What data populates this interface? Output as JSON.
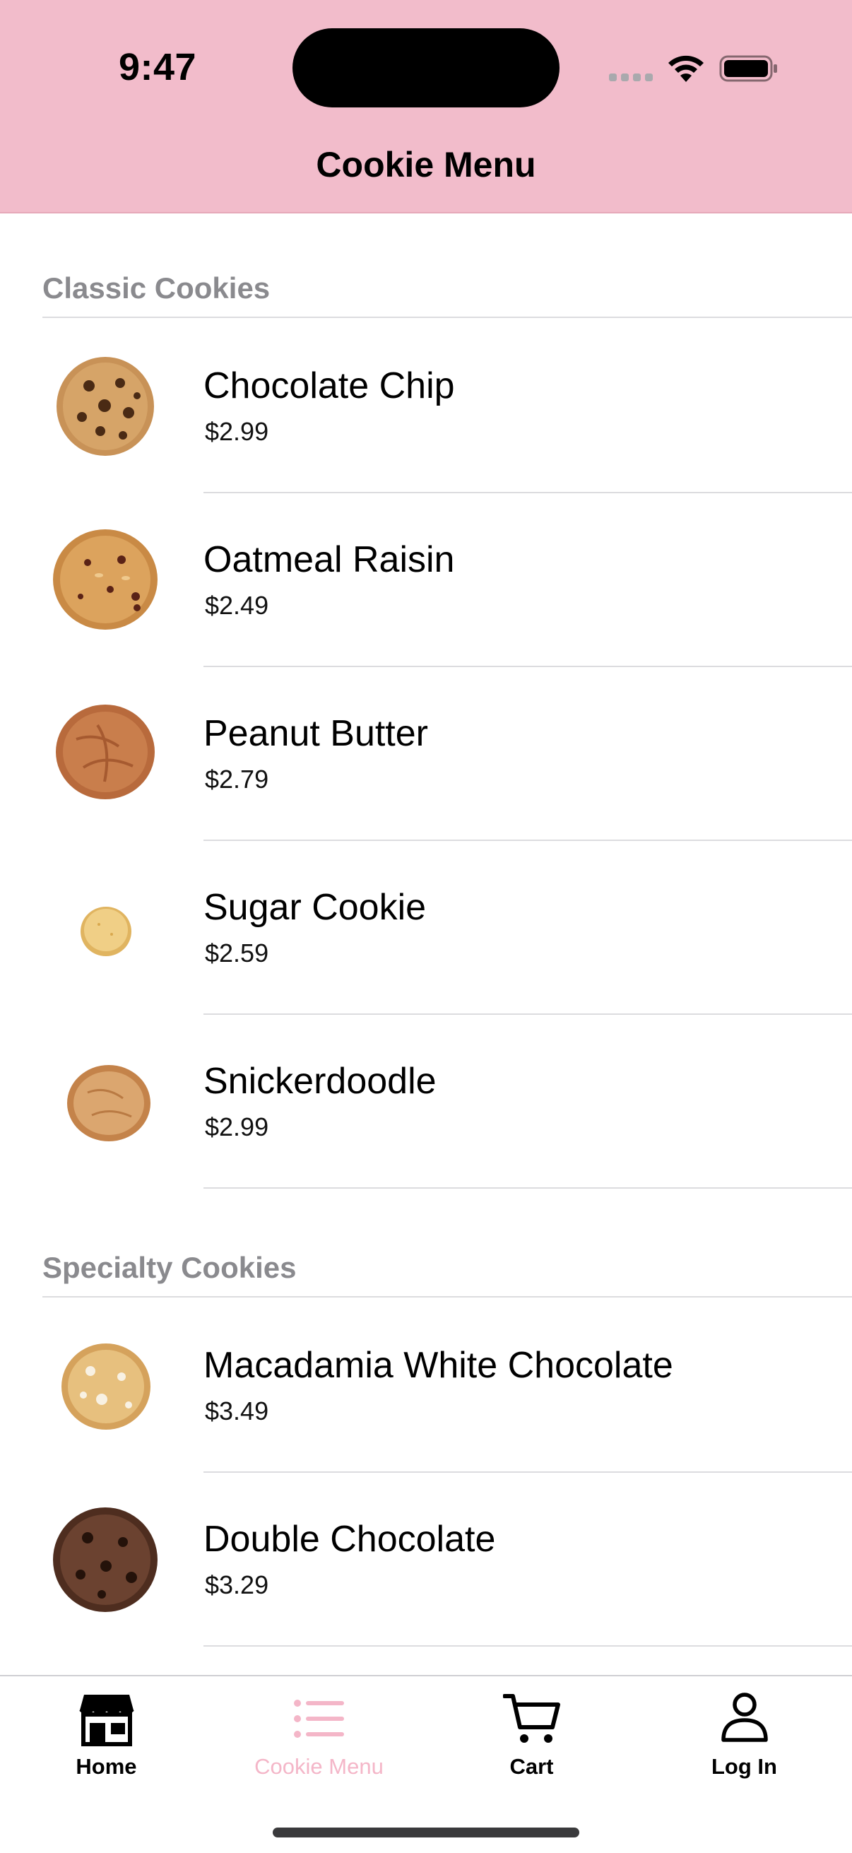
{
  "status_bar": {
    "time": "9:47"
  },
  "nav": {
    "title": "Cookie Menu"
  },
  "sections": [
    {
      "title": "Classic Cookies",
      "items": [
        {
          "name": "Chocolate Chip",
          "price": "$2.99",
          "image": "chocolate-chip-cookie"
        },
        {
          "name": "Oatmeal Raisin",
          "price": "$2.49",
          "image": "oatmeal-raisin-cookie"
        },
        {
          "name": "Peanut Butter",
          "price": "$2.79",
          "image": "peanut-butter-cookie"
        },
        {
          "name": "Sugar Cookie",
          "price": "$2.59",
          "image": "sugar-cookie"
        },
        {
          "name": "Snickerdoodle",
          "price": "$2.99",
          "image": "snickerdoodle-cookie"
        }
      ]
    },
    {
      "title": "Specialty Cookies",
      "items": [
        {
          "name": "Macadamia White Chocolate",
          "price": "$3.49",
          "image": "macadamia-cookie"
        },
        {
          "name": "Double Chocolate",
          "price": "$3.29",
          "image": "double-chocolate-cookie"
        }
      ]
    }
  ],
  "tab_bar": {
    "tabs": [
      {
        "label": "Home",
        "icon": "storefront-icon",
        "active": false
      },
      {
        "label": "Cookie Menu",
        "icon": "list-icon",
        "active": true
      },
      {
        "label": "Cart",
        "icon": "cart-icon",
        "active": false
      },
      {
        "label": "Log In",
        "icon": "person-icon",
        "active": false
      }
    ]
  },
  "colors": {
    "header_bg": "#f2bccb",
    "active_tab": "#f4b6c8",
    "section_header_text": "#8a8a8e",
    "separator": "#dcdcdf"
  }
}
